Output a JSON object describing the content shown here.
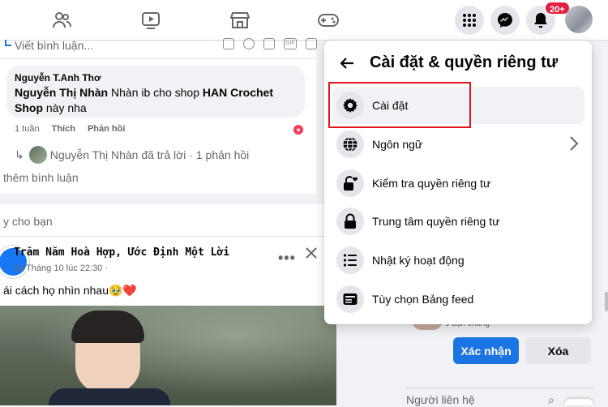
{
  "topbar": {
    "notification_badge": "20+"
  },
  "feed": {
    "comment_placeholder": "Viết bình luận...",
    "comment": {
      "author": "Nguyễn T.Anh Thơ",
      "mention": "Nguyễn Thị Nhàn",
      "text": " Nhàn ib cho shop ",
      "shop": "HAN Crochet Shop",
      "text2": "này nha",
      "time": "1 tuần",
      "like": "Thích",
      "reply": "Phản hồi",
      "reply_summary": "Nguyễn Thị Nhàn đã trả lời · 1 phản hồi"
    },
    "more_comments": "thêm bình luận",
    "suggest_label": "y cho bạn",
    "post": {
      "page_name": "Trăm Năm Hoà Hợp, Ước Định Một Lời",
      "date": "18 Tháng 10 lúc 22:30 ·",
      "caption": "ái cách họ nhìn nhau🥹❤️"
    }
  },
  "menu": {
    "title": "Cài đặt & quyền riêng tư",
    "items": [
      {
        "label": "Cài đặt",
        "icon": "gear-icon"
      },
      {
        "label": "Ngôn ngữ",
        "icon": "globe-icon"
      },
      {
        "label": "Kiểm tra quyền riêng tư",
        "icon": "lock-heart-icon"
      },
      {
        "label": "Trung tâm quyền riêng tư",
        "icon": "lock-icon"
      },
      {
        "label": "Nhật ký hoạt động",
        "icon": "list-icon"
      },
      {
        "label": "Tùy chọn Bảng feed",
        "icon": "feed-icon"
      }
    ]
  },
  "right": {
    "mutual": "9 bạn chung",
    "confirm": "Xác nhận",
    "delete": "Xóa",
    "contacts": "Người liên hệ"
  },
  "colors": {
    "accent": "#1b74e4",
    "highlight_border": "#e1141b"
  }
}
